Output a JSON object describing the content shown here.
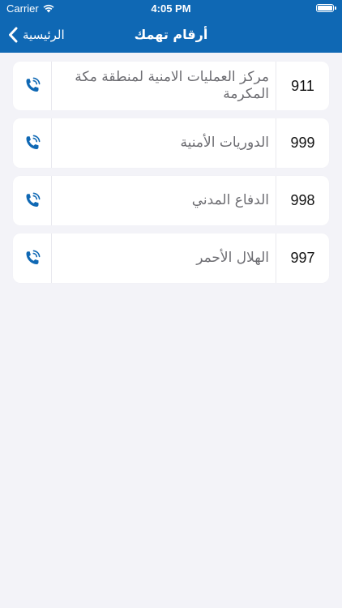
{
  "status_bar": {
    "carrier": "Carrier",
    "time": "4:05 PM",
    "battery_level": 1.0
  },
  "nav": {
    "title": "أرقام تهمك",
    "back_label": "الرئيسية",
    "accent_color": "#0f68b4"
  },
  "contacts": [
    {
      "number": "911",
      "name": "مركز العمليات الامنية لمنطقة مكة المكرمة",
      "icon": "phone-call-icon"
    },
    {
      "number": "999",
      "name": "الدوريات الأمنية",
      "icon": "phone-call-icon"
    },
    {
      "number": "998",
      "name": "الدفاع المدني",
      "icon": "phone-call-icon"
    },
    {
      "number": "997",
      "name": "الهلال الأحمر",
      "icon": "phone-call-icon"
    }
  ]
}
